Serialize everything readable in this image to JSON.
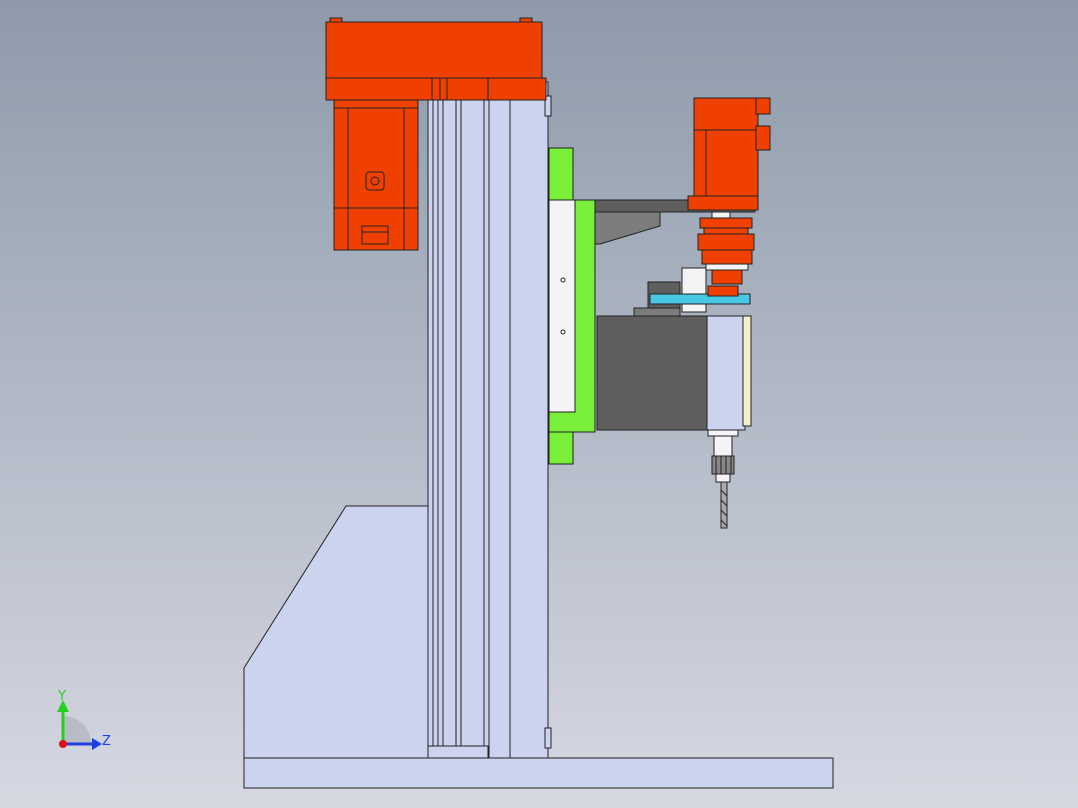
{
  "viewport": {
    "background_top": "#8e9aaa",
    "background_bottom": "#d6d8e2"
  },
  "colors": {
    "motor_orange": "#f04000",
    "motor_dark": "#c03000",
    "body_blue": "#ccd3ef",
    "green": "#79ef3a",
    "gray_dark": "#5e5e5e",
    "gray_mid": "#7c7c7c",
    "cyan": "#48c8e4",
    "white_block": "#f4f4f6",
    "yellow_face": "#f3efc9"
  },
  "triad": {
    "y_label": "Y",
    "z_label": "Z",
    "y_color": "#23d020",
    "z_color": "#1f3fe0",
    "x_color": "#e01010"
  },
  "parts": [
    "base-plate-icon",
    "column-icon",
    "side-support-icon",
    "top-motor-icon",
    "carriage-plate-icon",
    "spindle-motor-icon",
    "coupling-icon",
    "spindle-housing-icon",
    "drill-chuck-icon",
    "drill-bit-icon"
  ]
}
